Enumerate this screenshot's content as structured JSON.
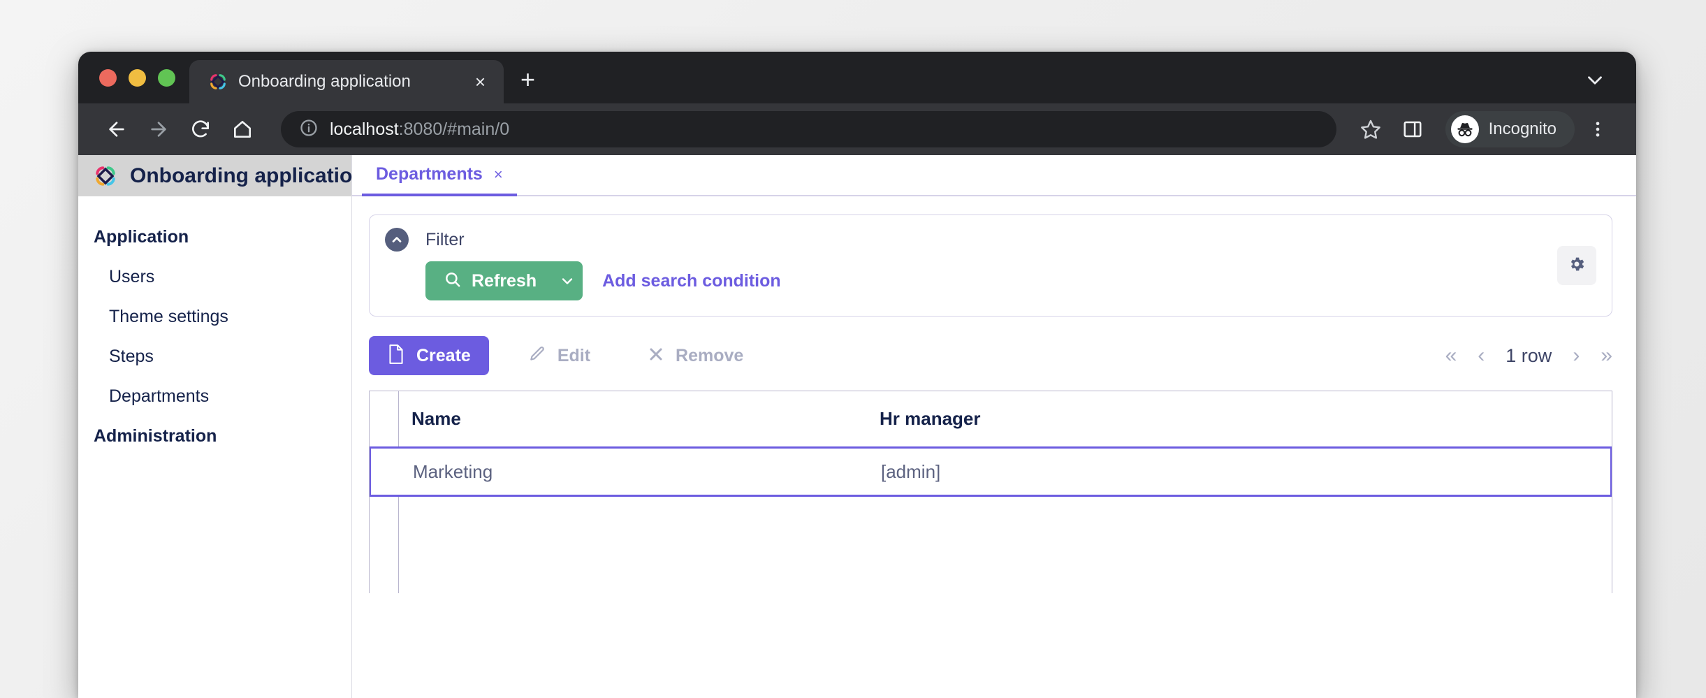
{
  "browser": {
    "tab": {
      "title": "Onboarding application",
      "favicon_name": "onboarding-logo-icon",
      "close_label": "×"
    },
    "new_tab_label": "+",
    "toolbar": {
      "back_icon": "back-arrow-icon",
      "forward_icon": "forward-arrow-icon",
      "reload_icon": "reload-icon",
      "home_icon": "home-icon",
      "url_host": "localhost",
      "url_rest": ":8080/#main/0",
      "info_icon": "site-info-icon",
      "star_icon": "bookmark-star-icon",
      "side_panel_icon": "side-panel-icon",
      "profile_label": "Incognito",
      "profile_icon": "incognito-icon",
      "menu_icon": "kebab-menu-icon"
    },
    "tab_list_icon": "chevron-down-icon"
  },
  "app": {
    "title": "Onboarding application",
    "logo_icon": "onboarding-logo-icon"
  },
  "sidebar": {
    "groups": [
      {
        "label": "Application",
        "items": [
          {
            "label": "Users"
          },
          {
            "label": "Theme settings"
          },
          {
            "label": "Steps"
          },
          {
            "label": "Departments"
          }
        ]
      },
      {
        "label": "Administration",
        "items": []
      }
    ]
  },
  "content_tabs": [
    {
      "label": "Departments",
      "close_label": "×",
      "active": true
    }
  ],
  "filter": {
    "title": "Filter",
    "toggle_icon": "chevron-up-circle-icon",
    "refresh": {
      "label": "Refresh",
      "icon": "search-icon",
      "dropdown_icon": "chevron-down-icon",
      "color": "#58b083"
    },
    "add_condition_label": "Add search condition",
    "settings_icon": "gear-icon"
  },
  "actions": {
    "create": {
      "label": "Create",
      "icon": "document-icon",
      "color": "#6c5ce0",
      "enabled": true
    },
    "edit": {
      "label": "Edit",
      "icon": "pencil-icon",
      "enabled": false
    },
    "remove": {
      "label": "Remove",
      "icon": "cross-icon",
      "enabled": false
    }
  },
  "pager": {
    "first_label": "«",
    "prev_label": "‹",
    "status": "1 row",
    "next_label": "›",
    "last_label": "»"
  },
  "table": {
    "columns": [
      {
        "key": "name",
        "label": "Name"
      },
      {
        "key": "hr_manager",
        "label": "Hr manager"
      }
    ],
    "rows": [
      {
        "name": "Marketing",
        "hr_manager": "[admin]",
        "selected": true
      }
    ]
  },
  "colors": {
    "accent_purple": "#6c5ce0",
    "accent_green": "#58b083",
    "text_navy": "#15224a",
    "muted": "#a9adc2"
  }
}
